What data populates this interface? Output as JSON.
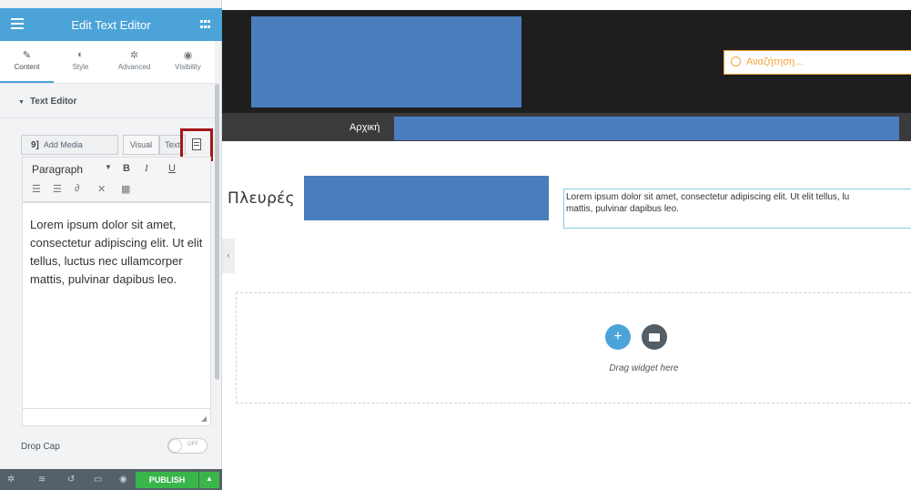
{
  "panel": {
    "title": "Edit Text Editor",
    "tabs": [
      {
        "label": "Content",
        "icon": "pencil-icon",
        "glyph": "✎"
      },
      {
        "label": "Style",
        "icon": "half-circle-icon",
        "glyph": "◐"
      },
      {
        "label": "Advanced",
        "icon": "gear-icon",
        "glyph": "✲"
      },
      {
        "label": "Visibility",
        "icon": "eye-icon",
        "glyph": "◉"
      }
    ],
    "section_title": "Text Editor",
    "add_media_label": "Add Media",
    "visual_tab": "Visual",
    "text_tab": "Text",
    "format_select": "Paragraph",
    "toolbar_bold": "B",
    "toolbar_italic": "I",
    "toolbar_underline": "U",
    "editor_text": "Lorem ipsum dolor sit amet, consectetur adipiscing elit. Ut elit tellus, luctus nec ullamcorper mattis, pulvinar dapibus leo.",
    "drop_cap_label": "Drop Cap",
    "drop_cap_state": "OFF",
    "publish_label": "PUBLISH"
  },
  "preview": {
    "search_placeholder": "Αναζήτηση...",
    "nav_home": "Αρχική",
    "heading": "Πλευρές",
    "lorem_text": "Lorem ipsum dolor sit amet, consectetur adipiscing elit. Ut elit tellus, lu\nmattis, pulvinar dapibus leo.",
    "drag_text": "Drag widget here",
    "collapse_glyph": "‹"
  },
  "colors": {
    "accent": "#4ba3d8",
    "publish": "#39b54a",
    "highlight": "#a4161a",
    "placeholder_blue": "#4a7dbd",
    "search_orange": "#f2a13a"
  }
}
